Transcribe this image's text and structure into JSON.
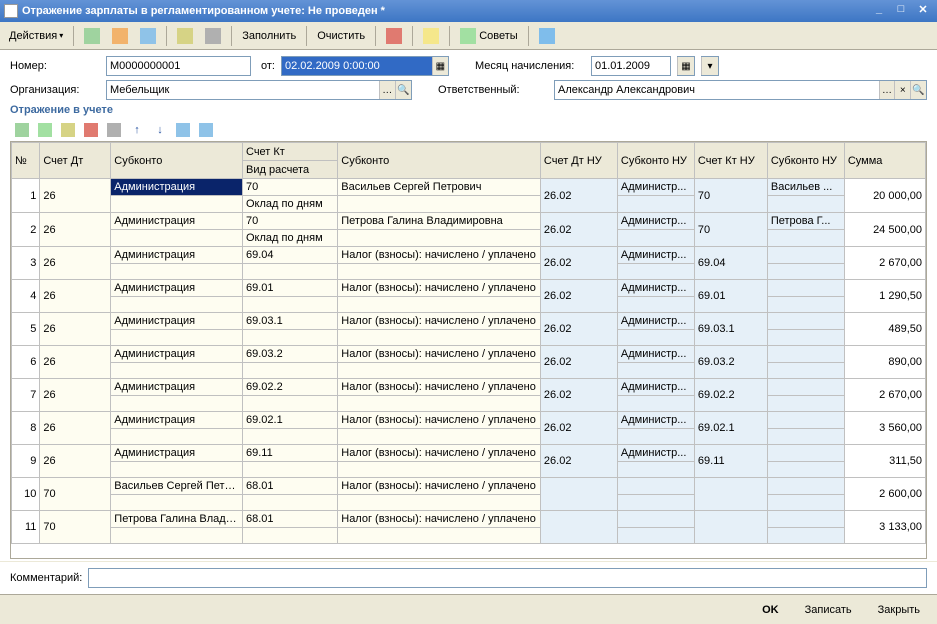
{
  "window": {
    "title": "Отражение зарплаты в регламентированном учете: Не проведен *"
  },
  "toolbar": {
    "actions": "Действия",
    "fill": "Заполнить",
    "clear": "Очистить",
    "advice": "Советы"
  },
  "form": {
    "number_label": "Номер:",
    "number_value": "М0000000001",
    "from_label": "от:",
    "from_value": "02.02.2009 0:00:00",
    "org_label": "Организация:",
    "org_value": "Мебельщик",
    "month_label": "Месяц начисления:",
    "month_value": "01.01.2009",
    "resp_label": "Ответственный:",
    "resp_value": "Александр Александрович"
  },
  "section": {
    "title": "Отражение в учете"
  },
  "headers": {
    "num": "№",
    "schet_dt": "Счет Дт",
    "subkonto": "Субконто",
    "schet_kt": "Счет Кт",
    "subkonto2": "Субконто",
    "schet_dt_nu": "Счет Дт НУ",
    "subkonto_nu": "Субконто НУ",
    "schet_kt_nu": "Счет Кт НУ",
    "subkonto_nu2": "Субконто НУ",
    "summa": "Сумма",
    "vid_rascheta": "Вид расчета"
  },
  "rows": [
    {
      "n": "1",
      "dt": "26",
      "sub1": "Администрация",
      "kt": "70",
      "vid": "Оклад по дням",
      "sub2": "Васильев Сергей Петрович",
      "dtnu": "26.02",
      "subnu": "Администр...",
      "ktnu": "70",
      "subnu2": "Васильев ...",
      "sum": "20 000,00"
    },
    {
      "n": "2",
      "dt": "26",
      "sub1": "Администрация",
      "kt": "70",
      "vid": "Оклад по дням",
      "sub2": "Петрова Галина Владимировна",
      "dtnu": "26.02",
      "subnu": "Администр...",
      "ktnu": "70",
      "subnu2": "Петрова Г...",
      "sum": "24 500,00"
    },
    {
      "n": "3",
      "dt": "26",
      "sub1": "Администрация",
      "kt": "69.04",
      "vid": "",
      "sub2": "Налог (взносы): начислено / уплачено",
      "dtnu": "26.02",
      "subnu": "Администр...",
      "ktnu": "69.04",
      "subnu2": "",
      "sum": "2 670,00"
    },
    {
      "n": "4",
      "dt": "26",
      "sub1": "Администрация",
      "kt": "69.01",
      "vid": "",
      "sub2": "Налог (взносы): начислено / уплачено",
      "dtnu": "26.02",
      "subnu": "Администр...",
      "ktnu": "69.01",
      "subnu2": "",
      "sum": "1 290,50"
    },
    {
      "n": "5",
      "dt": "26",
      "sub1": "Администрация",
      "kt": "69.03.1",
      "vid": "",
      "sub2": "Налог (взносы): начислено / уплачено",
      "dtnu": "26.02",
      "subnu": "Администр...",
      "ktnu": "69.03.1",
      "subnu2": "",
      "sum": "489,50"
    },
    {
      "n": "6",
      "dt": "26",
      "sub1": "Администрация",
      "kt": "69.03.2",
      "vid": "",
      "sub2": "Налог (взносы): начислено / уплачено",
      "dtnu": "26.02",
      "subnu": "Администр...",
      "ktnu": "69.03.2",
      "subnu2": "",
      "sum": "890,00"
    },
    {
      "n": "7",
      "dt": "26",
      "sub1": "Администрация",
      "kt": "69.02.2",
      "vid": "",
      "sub2": "Налог (взносы): начислено / уплачено",
      "dtnu": "26.02",
      "subnu": "Администр...",
      "ktnu": "69.02.2",
      "subnu2": "",
      "sum": "2 670,00"
    },
    {
      "n": "8",
      "dt": "26",
      "sub1": "Администрация",
      "kt": "69.02.1",
      "vid": "",
      "sub2": "Налог (взносы): начислено / уплачено",
      "dtnu": "26.02",
      "subnu": "Администр...",
      "ktnu": "69.02.1",
      "subnu2": "",
      "sum": "3 560,00"
    },
    {
      "n": "9",
      "dt": "26",
      "sub1": "Администрация",
      "kt": "69.11",
      "vid": "",
      "sub2": "Налог (взносы): начислено / уплачено",
      "dtnu": "26.02",
      "subnu": "Администр...",
      "ktnu": "69.11",
      "subnu2": "",
      "sum": "311,50"
    },
    {
      "n": "10",
      "dt": "70",
      "sub1": "Васильев Сергей Петров...",
      "kt": "68.01",
      "vid": "",
      "sub2": "Налог (взносы): начислено / уплачено",
      "dtnu": "",
      "subnu": "",
      "ktnu": "",
      "subnu2": "",
      "sum": "2 600,00"
    },
    {
      "n": "11",
      "dt": "70",
      "sub1": "Петрова Галина Владим...",
      "kt": "68.01",
      "vid": "",
      "sub2": "Налог (взносы): начислено / уплачено",
      "dtnu": "",
      "subnu": "",
      "ktnu": "",
      "subnu2": "",
      "sum": "3 133,00"
    }
  ],
  "footer": {
    "comment_label": "Комментарий:",
    "comment_value": ""
  },
  "buttons": {
    "ok": "OK",
    "write": "Записать",
    "close": "Закрыть"
  }
}
